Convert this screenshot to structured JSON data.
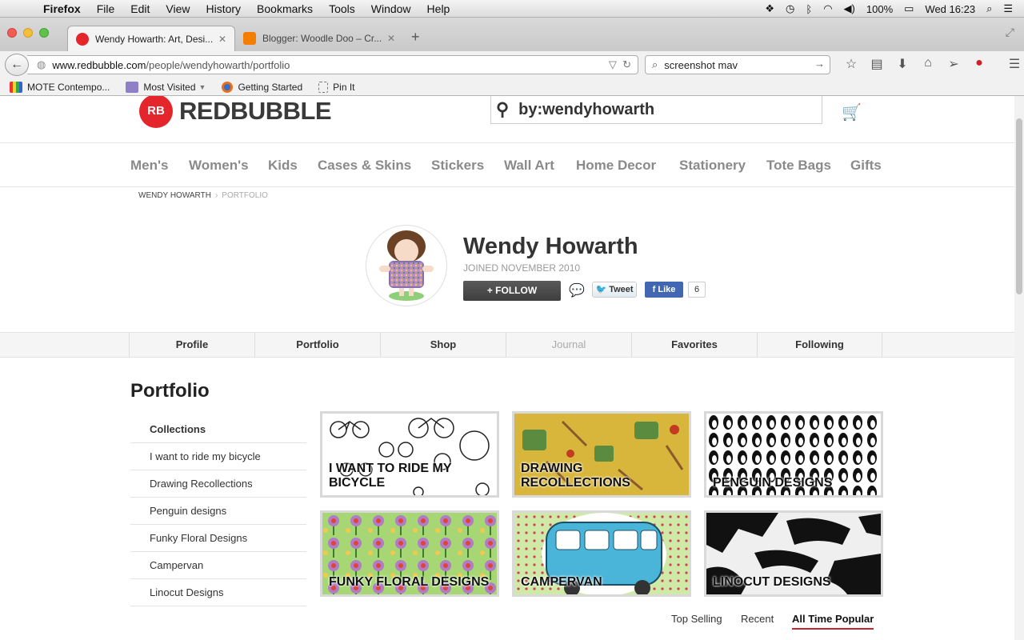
{
  "os_menubar": {
    "app": "Firefox",
    "menus": [
      "File",
      "Edit",
      "View",
      "History",
      "Bookmarks",
      "Tools",
      "Window",
      "Help"
    ],
    "battery": "100%",
    "clock": "Wed 16:23"
  },
  "browser": {
    "tabs": [
      {
        "title": "Wendy Howarth: Art, Desi...",
        "active": true,
        "favicon_color": "#e4252c"
      },
      {
        "title": "Blogger: Woodle Doo – Cr...",
        "active": false,
        "favicon_color": "#f57d00"
      }
    ],
    "url_host": "www.redbubble.com",
    "url_path": "/people/wendyhowarth/portfolio",
    "search_value": "screenshot mav",
    "bookmarks": [
      "MOTE Contempo...",
      "Most Visited",
      "Getting Started",
      "Pin It"
    ]
  },
  "site": {
    "logo_text": "REDBUBBLE",
    "logo_mark": "RB",
    "search_value": "by:wendyhowarth",
    "categories": [
      "Men's",
      "Women's",
      "Kids",
      "Cases & Skins",
      "Stickers",
      "Wall Art",
      "Home Decor",
      "Stationery",
      "Tote Bags",
      "Gifts"
    ]
  },
  "breadcrumb": {
    "parent": "Wendy Howarth",
    "current": "Portfolio"
  },
  "profile": {
    "name": "Wendy Howarth",
    "joined": "Joined November 2010",
    "follow_label": "+ FOLLOW",
    "tweet_label": "Tweet",
    "like_label": "Like",
    "like_count": "6"
  },
  "profile_tabs": [
    {
      "label": "Profile",
      "enabled": true
    },
    {
      "label": "Portfolio",
      "enabled": true
    },
    {
      "label": "Shop",
      "enabled": true
    },
    {
      "label": "Journal",
      "enabled": false
    },
    {
      "label": "Favorites",
      "enabled": true
    },
    {
      "label": "Following",
      "enabled": true
    }
  ],
  "portfolio": {
    "title": "Portfolio",
    "collections_header": "Collections",
    "collections": [
      "I want to ride my bicycle",
      "Drawing Recollections",
      "Penguin designs",
      "Funky Floral Designs",
      "Campervan",
      "Linocut Designs"
    ],
    "tiles": [
      {
        "label": "I want to ride my bicycle",
        "bg": "#ffffff"
      },
      {
        "label": "Drawing Recollections",
        "bg": "#d9b53a"
      },
      {
        "label": "Penguin designs",
        "bg": "#ffffff"
      },
      {
        "label": "Funky Floral Designs",
        "bg": "#9fd36b"
      },
      {
        "label": "Campervan",
        "bg": "#cfe9a6"
      },
      {
        "label": "Linocut Designs",
        "bg": "#f2f2f2"
      }
    ],
    "sort_options": [
      "Top Selling",
      "Recent",
      "All Time Popular"
    ],
    "active_sort": "All Time Popular"
  }
}
